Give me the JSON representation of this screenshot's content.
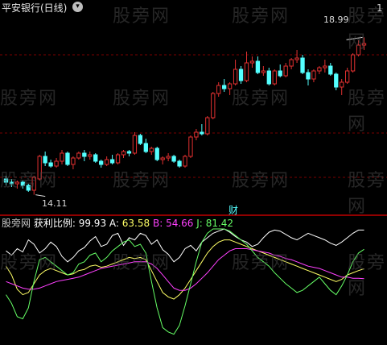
{
  "header": {
    "title": "平安银行(日线)",
    "collapse_icon": "chevron-down-icon",
    "right_badge": "1",
    "right_badge_color": "#d0d0d0"
  },
  "watermark": "股旁网",
  "colors": {
    "up": "#e23030",
    "down": "#54ffff",
    "grid": "#7a0000",
    "separator": "#c00000",
    "white_line": "#ffffff",
    "yellow_line": "#ffff66",
    "magenta_line": "#ff40ff",
    "green_line": "#66ff66",
    "label_grey": "#c8c8c8"
  },
  "indicator": {
    "name": "股旁网",
    "formula_label": "获利比例:",
    "formula_value": "99.93",
    "a_label": "A:",
    "a_value": "63.58",
    "b_label": "B:",
    "b_value": "54.66",
    "j_label": "J:",
    "j_value": "81.42"
  },
  "annotations": {
    "high_label": "18.99",
    "low_label": "14.11",
    "event_marker": "财"
  },
  "chart_data": [
    {
      "type": "candlestick",
      "ylim": [
        13.6,
        19.7
      ],
      "grid": true,
      "candles": [
        [
          14.6,
          14.7,
          14.4,
          14.5
        ],
        [
          14.5,
          14.6,
          14.35,
          14.45
        ],
        [
          14.45,
          14.55,
          14.3,
          14.5
        ],
        [
          14.5,
          14.55,
          14.3,
          14.4
        ],
        [
          14.4,
          14.45,
          14.2,
          14.25
        ],
        [
          14.25,
          14.7,
          14.11,
          14.65
        ],
        [
          14.6,
          15.35,
          14.55,
          15.3
        ],
        [
          15.3,
          15.45,
          15.0,
          15.1
        ],
        [
          15.1,
          15.2,
          14.95,
          15.0
        ],
        [
          15.0,
          15.25,
          14.95,
          15.15
        ],
        [
          15.15,
          15.5,
          15.05,
          15.4
        ],
        [
          15.4,
          15.45,
          15.0,
          15.05
        ],
        [
          15.05,
          15.3,
          14.9,
          15.25
        ],
        [
          15.25,
          15.45,
          15.2,
          15.4
        ],
        [
          15.4,
          15.5,
          15.15,
          15.3
        ],
        [
          15.3,
          15.45,
          15.2,
          15.35
        ],
        [
          15.35,
          15.4,
          15.1,
          15.15
        ],
        [
          15.15,
          15.2,
          14.95,
          15.05
        ],
        [
          15.05,
          15.3,
          15.0,
          15.2
        ],
        [
          15.2,
          15.35,
          15.05,
          15.1
        ],
        [
          15.1,
          15.4,
          15.05,
          15.35
        ],
        [
          15.35,
          15.5,
          15.25,
          15.45
        ],
        [
          15.45,
          15.5,
          15.3,
          15.4
        ],
        [
          15.4,
          16.05,
          15.35,
          15.95
        ],
        [
          15.95,
          16.0,
          15.65,
          15.7
        ],
        [
          15.7,
          15.85,
          15.4,
          15.45
        ],
        [
          15.45,
          15.6,
          15.35,
          15.55
        ],
        [
          15.55,
          15.6,
          15.15,
          15.2
        ],
        [
          15.2,
          15.3,
          15.05,
          15.25
        ],
        [
          15.25,
          15.4,
          15.15,
          15.3
        ],
        [
          15.3,
          15.35,
          15.1,
          15.15
        ],
        [
          15.15,
          15.2,
          14.95,
          15.0
        ],
        [
          15.0,
          15.35,
          14.95,
          15.3
        ],
        [
          15.3,
          15.95,
          15.25,
          15.9
        ],
        [
          15.9,
          16.15,
          15.8,
          16.05
        ],
        [
          16.05,
          16.3,
          15.95,
          16.0
        ],
        [
          16.0,
          16.55,
          15.95,
          16.5
        ],
        [
          16.5,
          17.3,
          16.45,
          17.25
        ],
        [
          17.25,
          17.6,
          17.15,
          17.5
        ],
        [
          17.5,
          17.7,
          17.3,
          17.4
        ],
        [
          17.4,
          17.6,
          17.2,
          17.55
        ],
        [
          17.55,
          18.3,
          17.5,
          18.0
        ],
        [
          18.0,
          18.1,
          17.55,
          17.65
        ],
        [
          17.65,
          18.55,
          17.6,
          18.2
        ],
        [
          18.2,
          18.4,
          18.05,
          18.25
        ],
        [
          18.25,
          18.4,
          17.85,
          17.9
        ],
        [
          17.9,
          18.1,
          17.8,
          17.95
        ],
        [
          17.95,
          18.05,
          17.5,
          17.55
        ],
        [
          17.55,
          18.0,
          17.5,
          17.95
        ],
        [
          17.95,
          18.15,
          17.75,
          17.8
        ],
        [
          17.8,
          18.2,
          17.75,
          18.1
        ],
        [
          18.1,
          18.35,
          18.0,
          18.3
        ],
        [
          18.3,
          18.6,
          18.2,
          18.35
        ],
        [
          18.35,
          18.45,
          17.85,
          17.9
        ],
        [
          17.9,
          18.0,
          17.5,
          17.7
        ],
        [
          17.7,
          18.0,
          17.6,
          17.95
        ],
        [
          17.95,
          18.1,
          17.85,
          18.05
        ],
        [
          18.05,
          18.3,
          17.9,
          18.1
        ],
        [
          18.1,
          18.2,
          17.8,
          17.85
        ],
        [
          17.85,
          17.9,
          17.35,
          17.45
        ],
        [
          17.45,
          17.7,
          17.2,
          17.6
        ],
        [
          17.6,
          18.05,
          17.55,
          17.95
        ],
        [
          17.95,
          18.5,
          17.9,
          18.45
        ],
        [
          18.45,
          18.9,
          18.4,
          18.75
        ],
        [
          18.75,
          18.99,
          18.6,
          18.8
        ]
      ]
    },
    {
      "type": "line",
      "ylim": [
        0,
        100
      ],
      "series": [
        {
          "name": "获利比例",
          "values": [
            80,
            76,
            82,
            79,
            90,
            86,
            78,
            82,
            88,
            84,
            75,
            70,
            74,
            80,
            83,
            89,
            93,
            84,
            86,
            94,
            96,
            85,
            92,
            90,
            96,
            94,
            86,
            90,
            81,
            77,
            70,
            74,
            82,
            85,
            80,
            88,
            92,
            96,
            98,
            100,
            97,
            93,
            90,
            88,
            84,
            86,
            92,
            97,
            99,
            98,
            95,
            92,
            90,
            93,
            96,
            94,
            92,
            90,
            87,
            85,
            88,
            92,
            96,
            99,
            99
          ]
        },
        {
          "name": "A",
          "values": [
            66,
            58,
            45,
            40,
            42,
            50,
            58,
            62,
            64,
            62,
            60,
            58,
            59,
            62,
            63,
            66,
            67,
            65,
            66,
            68,
            70,
            72,
            74,
            73,
            74,
            72,
            62,
            52,
            42,
            38,
            36,
            40,
            46,
            54,
            62,
            70,
            78,
            84,
            88,
            90,
            90,
            88,
            86,
            84,
            82,
            80,
            78,
            76,
            74,
            72,
            70,
            68,
            66,
            64,
            62,
            60,
            58,
            56,
            54,
            52,
            54,
            58,
            60,
            62,
            63.58
          ]
        },
        {
          "name": "B",
          "values": [
            52,
            50,
            48,
            46,
            45,
            45,
            46,
            48,
            50,
            52,
            53,
            54,
            55,
            56,
            58,
            60,
            62,
            64,
            65,
            66,
            67,
            68,
            69,
            70,
            70,
            70,
            68,
            64,
            58,
            52,
            46,
            44,
            44,
            46,
            50,
            55,
            60,
            66,
            72,
            76,
            80,
            82,
            82,
            82,
            81,
            80,
            79,
            78,
            76,
            75,
            73,
            72,
            70,
            68,
            66,
            65,
            64,
            62,
            60,
            58,
            56,
            56,
            55,
            55,
            54.66
          ]
        },
        {
          "name": "J",
          "values": [
            40,
            32,
            20,
            18,
            28,
            52,
            72,
            74,
            70,
            66,
            62,
            58,
            60,
            68,
            70,
            76,
            78,
            70,
            74,
            80,
            84,
            88,
            90,
            84,
            86,
            78,
            52,
            28,
            10,
            6,
            4,
            12,
            30,
            50,
            70,
            88,
            96,
            100,
            100,
            100,
            98,
            94,
            90,
            86,
            80,
            74,
            70,
            66,
            60,
            55,
            50,
            46,
            42,
            44,
            48,
            52,
            56,
            50,
            44,
            40,
            48,
            58,
            70,
            78,
            81.42
          ]
        }
      ]
    }
  ]
}
